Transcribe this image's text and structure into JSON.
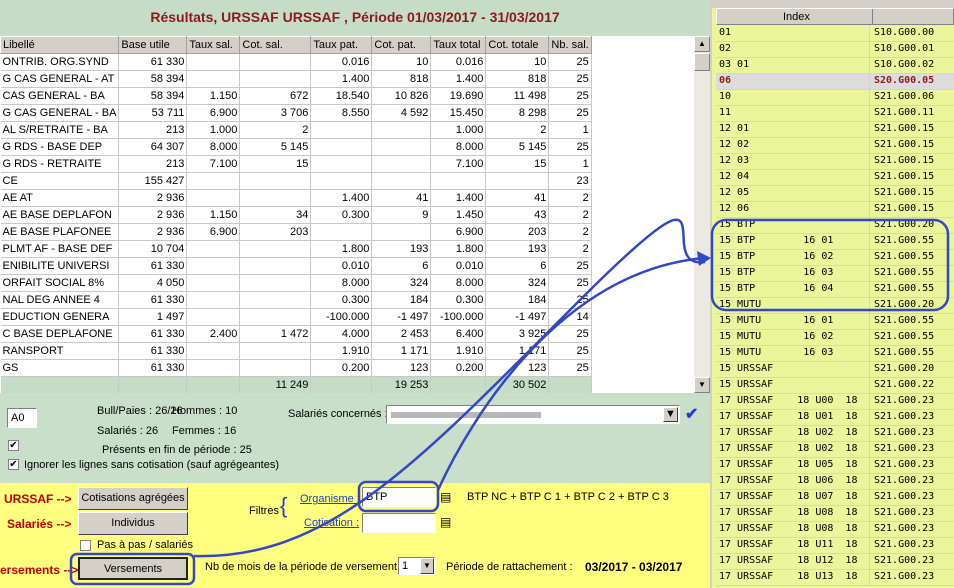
{
  "title": "Résultats, URSSAF URSSAF , Période 01/03/2017 - 31/03/2017",
  "grid": {
    "headers": [
      "Libellé",
      "Base utile",
      "Taux sal.",
      "Cot. sal.",
      "Taux pat.",
      "Cot. pat.",
      "Taux total",
      "Cot. totale",
      "Nb. sal."
    ],
    "rows": [
      [
        "ONTRIB. ORG.SYND",
        "61 330",
        "",
        "",
        "0.016",
        "10",
        "0.016",
        "10",
        "25"
      ],
      [
        "G CAS GENERAL - AT",
        "58 394",
        "",
        "",
        "1.400",
        "818",
        "1.400",
        "818",
        "25"
      ],
      [
        "CAS GENERAL - BA",
        "58 394",
        "1.150",
        "672",
        "18.540",
        "10 826",
        "19.690",
        "11 498",
        "25"
      ],
      [
        "G CAS GENERAL - BA",
        "53 711",
        "6.900",
        "3 706",
        "8.550",
        "4 592",
        "15.450",
        "8 298",
        "25"
      ],
      [
        "AL S/RETRAITE - BA",
        "213",
        "1.000",
        "2",
        "",
        "",
        "1.000",
        "2",
        "1"
      ],
      [
        "G RDS - BASE DEP",
        "64 307",
        "8.000",
        "5 145",
        "",
        "",
        "8.000",
        "5 145",
        "25"
      ],
      [
        "G RDS - RETRAITE",
        "213",
        "7.100",
        "15",
        "",
        "",
        "7.100",
        "15",
        "1"
      ],
      [
        "CE",
        "155 427",
        "",
        "",
        "",
        "",
        "",
        "",
        "23"
      ],
      [
        "AE AT",
        "2 936",
        "",
        "",
        "1.400",
        "41",
        "1.400",
        "41",
        "2"
      ],
      [
        "AE BASE DEPLAFON",
        "2 936",
        "1.150",
        "34",
        "0.300",
        "9",
        "1.450",
        "43",
        "2"
      ],
      [
        "AE BASE PLAFONEE",
        "2 936",
        "6.900",
        "203",
        "",
        "",
        "6.900",
        "203",
        "2"
      ],
      [
        "PLMT AF - BASE DEF",
        "10 704",
        "",
        "",
        "1.800",
        "193",
        "1.800",
        "193",
        "2"
      ],
      [
        "ENIBILITE UNIVERSI",
        "61 330",
        "",
        "",
        "0.010",
        "6",
        "0.010",
        "6",
        "25"
      ],
      [
        "ORFAIT SOCIAL 8%",
        "4 050",
        "",
        "",
        "8.000",
        "324",
        "8.000",
        "324",
        "25"
      ],
      [
        "NAL DEG ANNEE 4",
        "61 330",
        "",
        "",
        "0.300",
        "184",
        "0.300",
        "184",
        "25"
      ],
      [
        "EDUCTION GENERA",
        "1 497",
        "",
        "",
        "-100.000",
        "-1 497",
        "-100.000",
        "-1 497",
        "14"
      ],
      [
        "C BASE DEPLAFONE",
        "61 330",
        "2.400",
        "1 472",
        "4.000",
        "2 453",
        "6.400",
        "3 925",
        "25"
      ],
      [
        "RANSPORT",
        "61 330",
        "",
        "",
        "1.910",
        "1 171",
        "1.910",
        "1 171",
        "25"
      ],
      [
        "GS",
        "61 330",
        "",
        "",
        "0.200",
        "123",
        "0.200",
        "123",
        "25"
      ]
    ],
    "totals": [
      "",
      "",
      "",
      "11 249",
      "",
      "19 253",
      "",
      "30 502",
      ""
    ]
  },
  "info": {
    "code_value": "A0",
    "bull_paies": "Bull/Paies : 26/26",
    "hommes": "Hommes : 10",
    "salaries": "Salariés : 26",
    "femmes": "Femmes : 16",
    "presents": "Présents en fin de période : 25",
    "ignorer": "Ignorer les lignes sans cotisation (sauf agrégeantes)",
    "salaries_concernes_label": "Salariés concernés :",
    "check1": "✔",
    "check2": "✔"
  },
  "bottom": {
    "urssaf_label": "URSSAF -->",
    "salaries_label": "Salariés -->",
    "versements_label": "ersements -->",
    "btn_cotisations": "Cotisations agrégées",
    "btn_individus": "Individus",
    "pas_a_pas": "Pas à pas / salariés",
    "btn_versements": "Versements",
    "filtres": "Filtres",
    "organisme_label": "Organisme :",
    "organisme_value": "BTP",
    "cotisation_label": "Cotisation :",
    "cotisation_value": "",
    "btp_desc": "BTP NC + BTP C 1 + BTP C 2 + BTP C 3",
    "nb_mois_label": "Nb de mois de la période de versement :",
    "nb_mois_value": "1",
    "periode_label": "Période de rattachement :",
    "periode_value": "03/2017 - 03/2017"
  },
  "index": {
    "header": "Index",
    "rows": [
      [
        "01",
        "S10.G00.00"
      ],
      [
        "02",
        "S10.G00.01"
      ],
      [
        "03 01",
        "S10.G00.02"
      ],
      [
        "06",
        "S20.G00.05"
      ],
      [
        "10",
        "S21.G00.06"
      ],
      [
        "11",
        "S21.G00.11"
      ],
      [
        "12 01",
        "S21.G00.15"
      ],
      [
        "12 02",
        "S21.G00.15"
      ],
      [
        "12 03",
        "S21.G00.15"
      ],
      [
        "12 04",
        "S21.G00.15"
      ],
      [
        "12 05",
        "S21.G00.15"
      ],
      [
        "12 06",
        "S21.G00.15"
      ],
      [
        "15 BTP",
        "S21.G00.20"
      ],
      [
        "15 BTP        16 01",
        "S21.G00.55"
      ],
      [
        "15 BTP        16 02",
        "S21.G00.55"
      ],
      [
        "15 BTP        16 03",
        "S21.G00.55"
      ],
      [
        "15 BTP        16 04",
        "S21.G00.55"
      ],
      [
        "15 MUTU",
        "S21.G00.20"
      ],
      [
        "15 MUTU       16 01",
        "S21.G00.55"
      ],
      [
        "15 MUTU       16 02",
        "S21.G00.55"
      ],
      [
        "15 MUTU       16 03",
        "S21.G00.55"
      ],
      [
        "15 URSSAF",
        "S21.G00.20"
      ],
      [
        "15 URSSAF",
        "S21.G00.22"
      ],
      [
        "17 URSSAF    18 U00  18",
        "S21.G00.23"
      ],
      [
        "17 URSSAF    18 U01  18",
        "S21.G00.23"
      ],
      [
        "17 URSSAF    18 U02  18",
        "S21.G00.23"
      ],
      [
        "17 URSSAF    18 U02  18",
        "S21.G00.23"
      ],
      [
        "17 URSSAF    18 U05  18",
        "S21.G00.23"
      ],
      [
        "17 URSSAF    18 U06  18",
        "S21.G00.23"
      ],
      [
        "17 URSSAF    18 U07  18",
        "S21.G00.23"
      ],
      [
        "17 URSSAF    18 U08  18",
        "S21.G00.23"
      ],
      [
        "17 URSSAF    18 U08  18",
        "S21.G00.23"
      ],
      [
        "17 URSSAF    18 U11  18",
        "S21.G00.23"
      ],
      [
        "17 URSSAF    18 U12  18",
        "S21.G00.23"
      ],
      [
        "17 URSSAF    18 U13  18",
        "S21.G00.23"
      ]
    ],
    "selected": 3
  }
}
